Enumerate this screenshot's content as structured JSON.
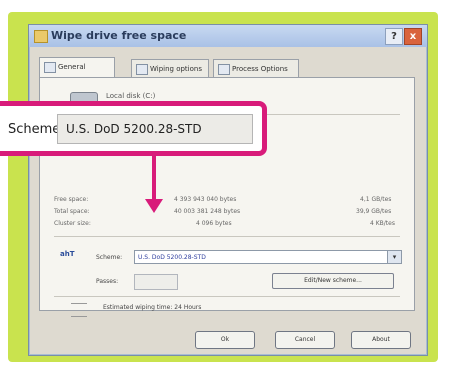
{
  "window": {
    "title": "Wipe drive free space",
    "help_glyph": "?",
    "close_glyph": "x"
  },
  "tabs": [
    {
      "label": "General"
    },
    {
      "label": "Wiping options"
    },
    {
      "label": "Process Options"
    }
  ],
  "drive": {
    "label": "Local disk (C:)"
  },
  "info_rows": [
    {
      "label": "Free space:",
      "bytes": "4 393 943 040 bytes",
      "size": "4,1 GB/tes"
    },
    {
      "label": "Total space:",
      "bytes": "40 003 381 248 bytes",
      "size": "39,9 GB/tes"
    },
    {
      "label": "Cluster size:",
      "bytes": "4 096 bytes",
      "size": "4 KB/tes"
    }
  ],
  "scheme": {
    "label": "Scheme:",
    "value": "U.S. DoD 5200.28-STD",
    "icon_text": "ahT",
    "dropdown_glyph": "▾"
  },
  "passes": {
    "label": "Passes:"
  },
  "edit_scheme_button": "Edit/New scheme...",
  "estimated": {
    "text": "Estimated wiping time: 24 Hours"
  },
  "buttons": {
    "ok": "Ok",
    "cancel": "Cancel",
    "about": "About"
  },
  "callout": {
    "label": "Scheme:",
    "value": "U.S. DoD 5200.28-STD"
  },
  "colors": {
    "frame": "#c9e34e",
    "callout_border": "#d81b7a",
    "scheme_text": "#2d3d9e"
  }
}
